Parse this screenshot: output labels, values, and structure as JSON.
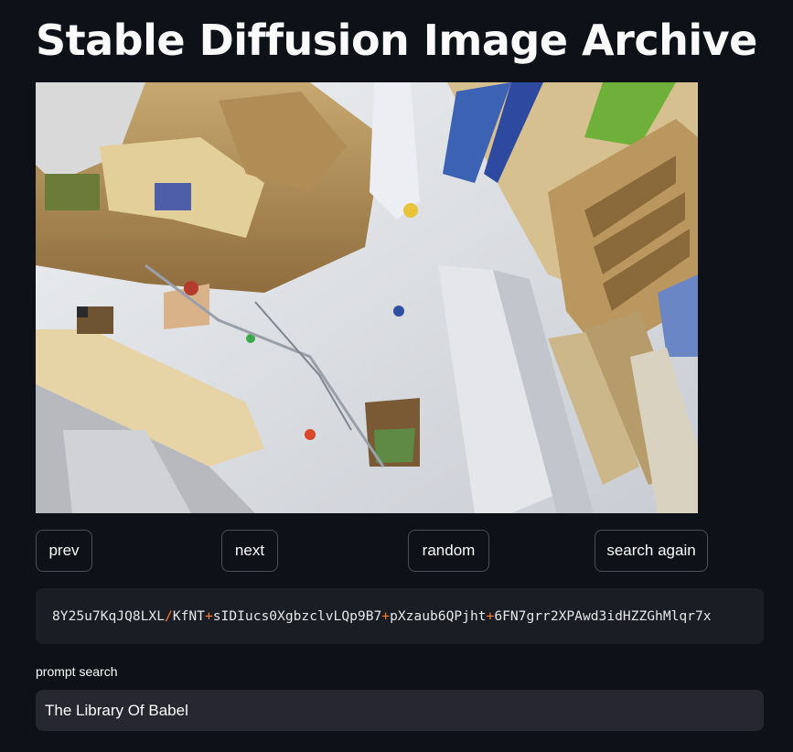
{
  "page": {
    "title": "Stable Diffusion Image Archive"
  },
  "image": {
    "alt": "The Library Of Babel"
  },
  "buttons": {
    "prev": "prev",
    "next": "next",
    "random": "random",
    "search_again": "search again"
  },
  "seed_code": {
    "segments": [
      {
        "text": "8Y25u7KqJQ8LXL",
        "kind": "text"
      },
      {
        "text": "/",
        "kind": "sep"
      },
      {
        "text": "KfNT",
        "kind": "text"
      },
      {
        "text": "+",
        "kind": "sep"
      },
      {
        "text": "sIDIucs0XgbzclvLQp9B7",
        "kind": "text"
      },
      {
        "text": "+",
        "kind": "sep"
      },
      {
        "text": "pXzaub6QPjht",
        "kind": "text"
      },
      {
        "text": "+",
        "kind": "sep"
      },
      {
        "text": "6FN7grr2XPAwd3idHZZGhMlqr7x",
        "kind": "text"
      }
    ],
    "separator_color": "#ff7b2e"
  },
  "prompt_search": {
    "label": "prompt search",
    "value": "The Library Of Babel"
  },
  "colors": {
    "background": "#0e1117",
    "panel": "#1b1d25",
    "input": "#262730",
    "text": "#fafafa"
  }
}
